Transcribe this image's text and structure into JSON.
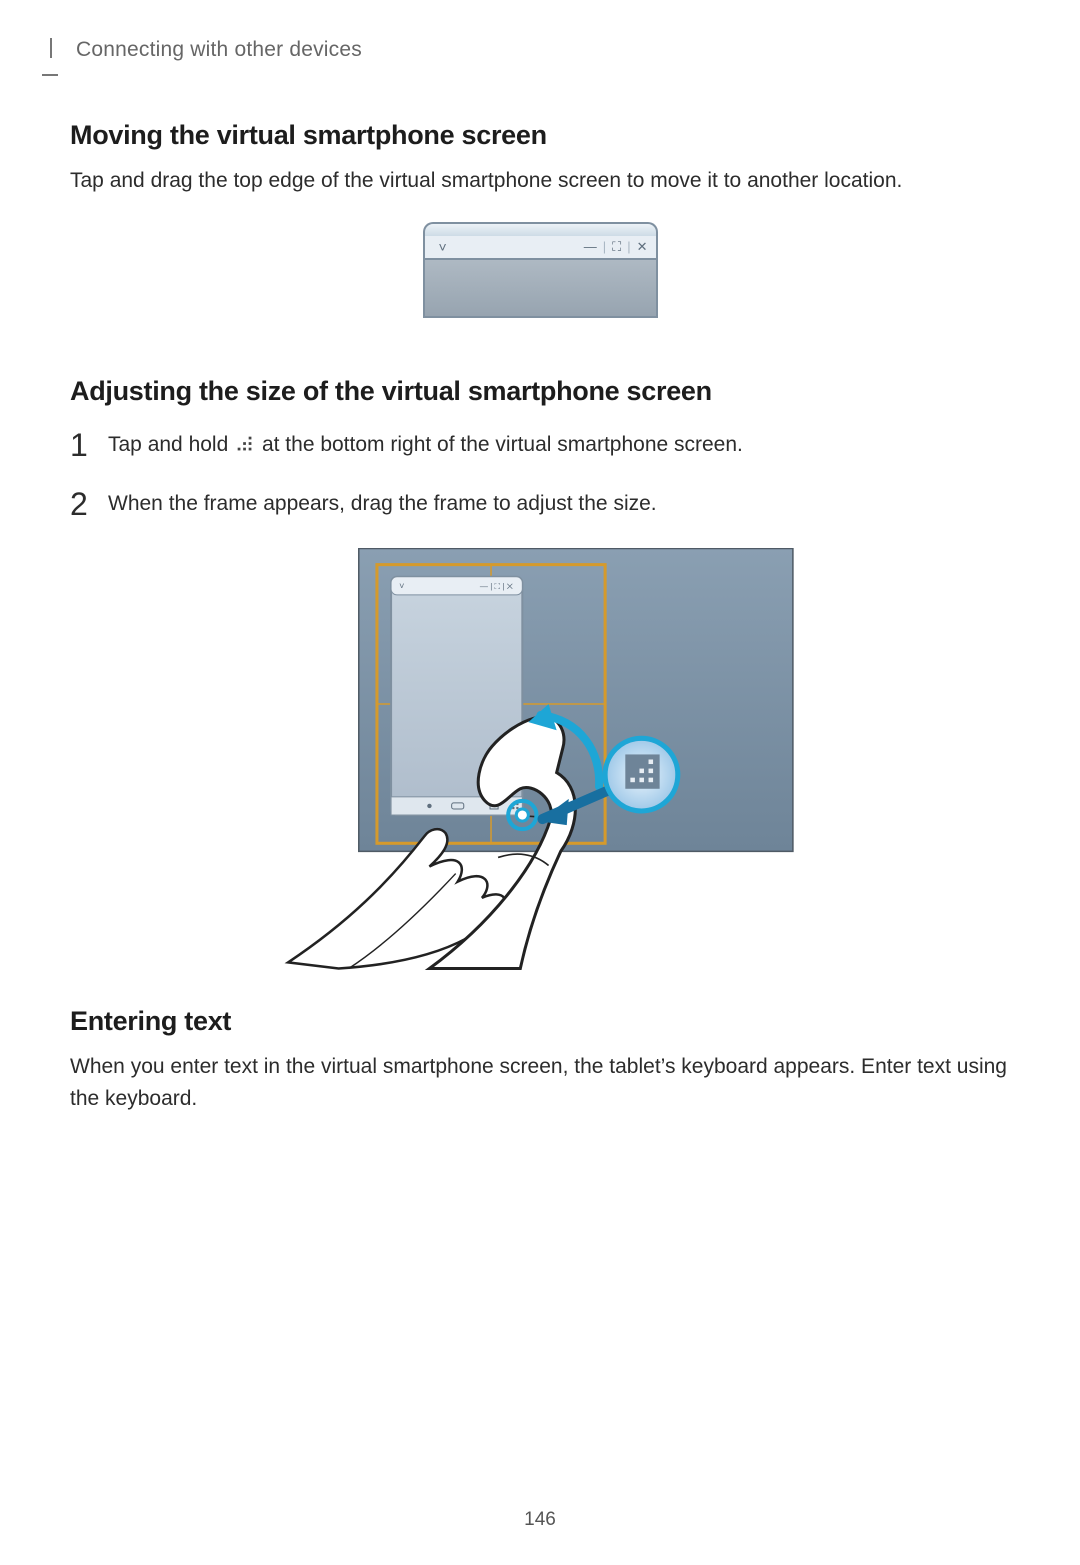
{
  "breadcrumb": "Connecting with other devices",
  "section1": {
    "title": "Moving the virtual smartphone screen",
    "body": "Tap and drag the top edge of the virtual smartphone screen to move it to another location."
  },
  "section2": {
    "title": "Adjusting the size of the virtual smartphone screen",
    "steps": [
      {
        "before": "Tap and hold ",
        "after": " at the bottom right of the virtual smartphone screen."
      },
      {
        "before": "When the frame appears, drag the frame to adjust the size.",
        "after": ""
      }
    ]
  },
  "section3": {
    "title": "Entering text",
    "body": "When you enter text in the virtual smartphone screen, the tablet’s keyboard appears. Enter text using the keyboard."
  },
  "titlebar": {
    "chevron": "˅",
    "minimize": "—",
    "maximize": "⛶",
    "close": "✕",
    "sep": "|"
  },
  "pagenum": "146",
  "icons": {
    "resizeHandle": "resize-handle-icon"
  }
}
